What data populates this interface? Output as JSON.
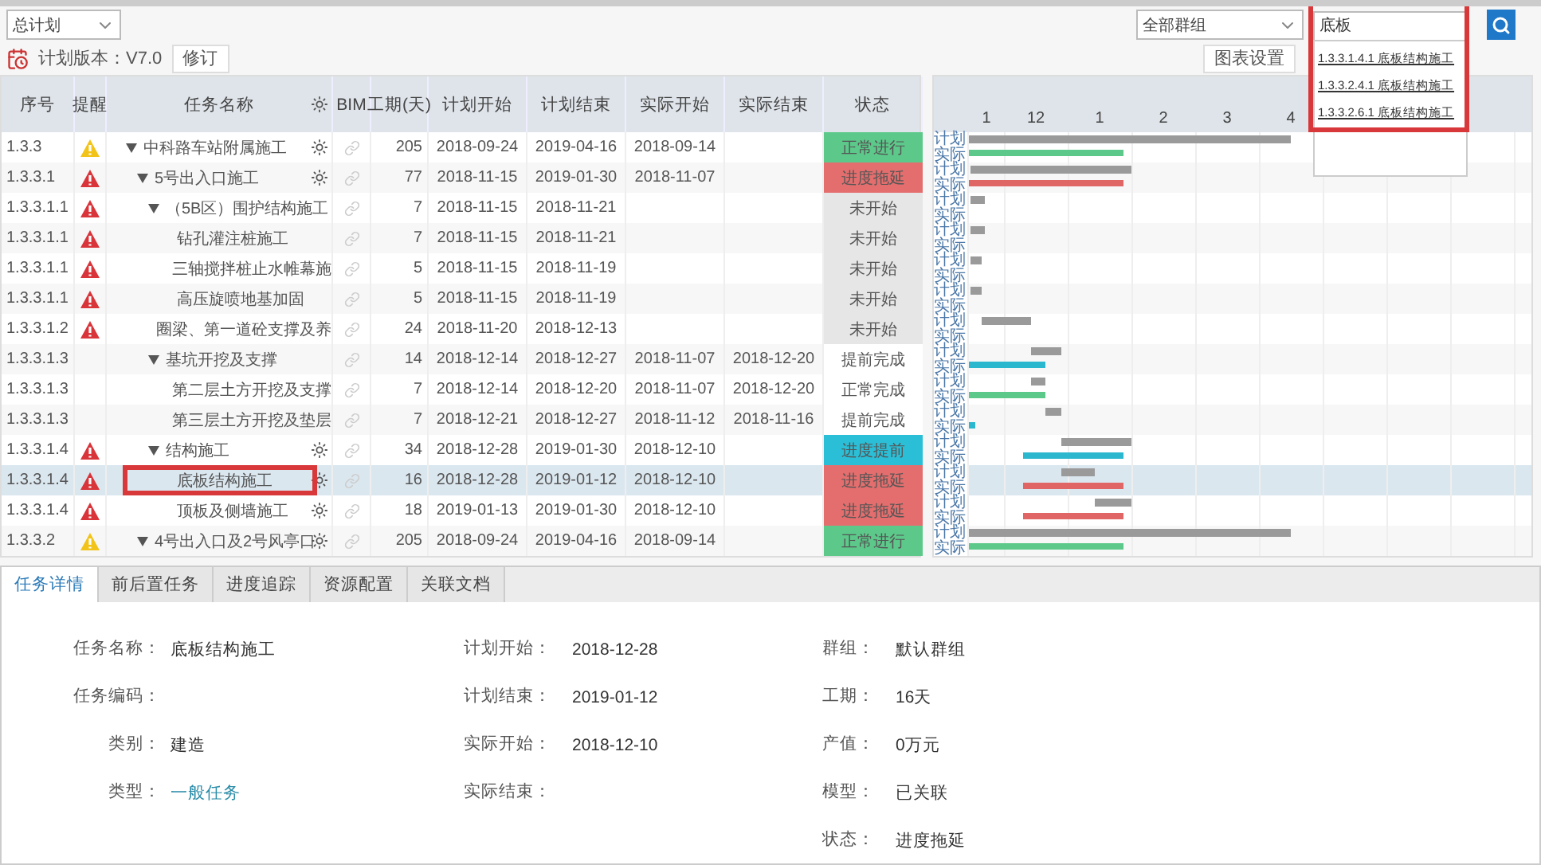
{
  "toolbar": {
    "plan_select": "总计划",
    "version_label": "计划版本：V7.0",
    "revise_button": "修订",
    "group_select": "全部群组",
    "search": {
      "value": "底板",
      "annotated": true,
      "results": [
        {
          "text": "1.3.3.1.4.1 底板结构施工"
        },
        {
          "text": "1.3.3.2.4.1 底板结构施工"
        },
        {
          "text": "1.3.3.2.6.1 底板结构施工"
        }
      ]
    },
    "chart_settings_button": "图表设置"
  },
  "table": {
    "columns": [
      "序号",
      "提醒",
      "任务名称",
      "BIM",
      "工期(天)",
      "计划开始",
      "计划结束",
      "实际开始",
      "实际结束",
      "状态"
    ],
    "rows": [
      {
        "seq": "1.3.3",
        "alert": {
          "color": "#f2c318"
        },
        "name": "中科路车站附属施工",
        "gear": true,
        "duration": "205",
        "plan_start": "2018-09-24",
        "plan_end": "2019-04-16",
        "actual_start": "2018-09-14",
        "status": {
          "text": "正常进行",
          "kind": "normal"
        },
        "expanded": true,
        "selected": false,
        "annotated": false,
        "children": [
          {
            "seq": "1.3.3.1",
            "alert": {
              "color": "#d8343a"
            },
            "name": "5号出入口施工",
            "gear": true,
            "duration": "77",
            "plan_start": "2018-11-15",
            "plan_end": "2019-01-30",
            "actual_start": "2018-11-07",
            "status": {
              "text": "进度拖延",
              "kind": "delayed"
            },
            "expanded": true,
            "selected": false,
            "annotated": false,
            "children": [
              {
                "seq": "1.3.3.1.1",
                "alert": {
                  "color": "#d8343a"
                },
                "name": "（5B区）围护结构施工",
                "gear": false,
                "duration": "7",
                "plan_start": "2018-11-15",
                "plan_end": "2018-11-21",
                "status": {
                  "text": "未开始",
                  "kind": "not_started"
                },
                "expanded": true,
                "selected": false,
                "annotated": false,
                "children": [
                  {
                    "seq": "1.3.3.1.1",
                    "alert": {
                      "color": "#d8343a"
                    },
                    "name": "钻孔灌注桩施工",
                    "gear": false,
                    "duration": "7",
                    "plan_start": "2018-11-15",
                    "plan_end": "2018-11-21",
                    "status": {
                      "text": "未开始",
                      "kind": "not_started"
                    },
                    "selected": false,
                    "annotated": false
                  },
                  {
                    "seq": "1.3.3.1.1",
                    "alert": {
                      "color": "#d8343a"
                    },
                    "name": "三轴搅拌桩止水帷幕施",
                    "gear": false,
                    "duration": "5",
                    "plan_start": "2018-11-15",
                    "plan_end": "2018-11-19",
                    "status": {
                      "text": "未开始",
                      "kind": "not_started"
                    },
                    "selected": false,
                    "annotated": false
                  },
                  {
                    "seq": "1.3.3.1.1",
                    "alert": {
                      "color": "#d8343a"
                    },
                    "name": "高压旋喷地基加固",
                    "gear": false,
                    "duration": "5",
                    "plan_start": "2018-11-15",
                    "plan_end": "2018-11-19",
                    "status": {
                      "text": "未开始",
                      "kind": "not_started"
                    },
                    "selected": false,
                    "annotated": false
                  }
                ]
              },
              {
                "seq": "1.3.3.1.2",
                "alert": {
                  "color": "#d8343a"
                },
                "name": "圈梁、第一道砼支撑及养",
                "gear": false,
                "duration": "24",
                "plan_start": "2018-11-20",
                "plan_end": "2018-12-13",
                "status": {
                  "text": "未开始",
                  "kind": "not_started"
                },
                "selected": false,
                "annotated": false
              },
              {
                "seq": "1.3.3.1.3",
                "name": "基坑开挖及支撑",
                "gear": false,
                "duration": "14",
                "plan_start": "2018-12-14",
                "plan_end": "2018-12-27",
                "actual_start": "2018-11-07",
                "actual_end": "2018-12-20",
                "status": {
                  "text": "提前完成",
                  "kind": "early_done"
                },
                "expanded": true,
                "selected": false,
                "annotated": false,
                "children": [
                  {
                    "seq": "1.3.3.1.3",
                    "name": "第二层土方开挖及支撑",
                    "gear": false,
                    "duration": "7",
                    "plan_start": "2018-12-14",
                    "plan_end": "2018-12-20",
                    "actual_start": "2018-11-07",
                    "actual_end": "2018-12-20",
                    "status": {
                      "text": "正常完成",
                      "kind": "normal_done"
                    },
                    "selected": false,
                    "annotated": false
                  },
                  {
                    "seq": "1.3.3.1.3",
                    "name": "第三层土方开挖及垫层",
                    "gear": false,
                    "duration": "7",
                    "plan_start": "2018-12-21",
                    "plan_end": "2018-12-27",
                    "actual_start": "2018-11-12",
                    "actual_end": "2018-11-16",
                    "status": {
                      "text": "提前完成",
                      "kind": "early_done"
                    },
                    "selected": false,
                    "annotated": false
                  }
                ]
              },
              {
                "seq": "1.3.3.1.4",
                "alert": {
                  "color": "#d8343a"
                },
                "name": "结构施工",
                "gear": true,
                "duration": "34",
                "plan_start": "2018-12-28",
                "plan_end": "2019-01-30",
                "actual_start": "2018-12-10",
                "status": {
                  "text": "进度提前",
                  "kind": "ahead"
                },
                "expanded": true,
                "selected": false,
                "annotated": false,
                "children": [
                  {
                    "seq": "1.3.3.1.4",
                    "alert": {
                      "color": "#d8343a"
                    },
                    "name": "底板结构施工",
                    "gear": true,
                    "duration": "16",
                    "plan_start": "2018-12-28",
                    "plan_end": "2019-01-12",
                    "actual_start": "2018-12-10",
                    "status": {
                      "text": "进度拖延",
                      "kind": "delayed"
                    },
                    "selected": true,
                    "annotated": true
                  },
                  {
                    "seq": "1.3.3.1.4",
                    "alert": {
                      "color": "#d8343a"
                    },
                    "name": "顶板及侧墙施工",
                    "gear": true,
                    "duration": "18",
                    "plan_start": "2019-01-13",
                    "plan_end": "2019-01-30",
                    "actual_start": "2018-12-10",
                    "status": {
                      "text": "进度拖延",
                      "kind": "delayed"
                    },
                    "selected": false,
                    "annotated": false
                  }
                ]
              }
            ]
          },
          {
            "seq": "1.3.3.2",
            "alert": {
              "color": "#f2c318"
            },
            "name": "4号出入口及2号风亭口",
            "gear": true,
            "duration": "205",
            "plan_start": "2018-09-24",
            "plan_end": "2019-04-16",
            "actual_start": "2018-09-14",
            "status": {
              "text": "正常进行",
              "kind": "normal"
            },
            "expanded": true,
            "selected": false,
            "annotated": false
          }
        ]
      }
    ]
  },
  "gantt": {
    "months": [
      "1",
      "12",
      "1",
      "2",
      "3",
      "4"
    ],
    "rows": [
      {
        "plan": "计划",
        "actual": "实际"
      },
      {
        "plan": "计划",
        "actual": "实际"
      },
      {
        "plan": "计划",
        "actual": "实际"
      },
      {
        "plan": "计划",
        "actual": "实际"
      },
      {
        "plan": "计划",
        "actual": "实际"
      },
      {
        "plan": "计划",
        "actual": "实际"
      },
      {
        "plan": "计划",
        "actual": "实际"
      },
      {
        "plan": "计划",
        "actual": "实际"
      },
      {
        "plan": "计划",
        "actual": "实际"
      },
      {
        "plan": "计划",
        "actual": "实际"
      },
      {
        "plan": "计划",
        "actual": "实际"
      },
      {
        "plan": "计划",
        "actual": "实际"
      },
      {
        "plan": "计划",
        "actual": "实际"
      },
      {
        "plan": "计划",
        "actual": "实际"
      }
    ]
  },
  "details": {
    "tabs": [
      {
        "label": "任务详情",
        "selected": true
      },
      {
        "label": "前后置任务",
        "selected": false
      },
      {
        "label": "进度追踪",
        "selected": false
      },
      {
        "label": "资源配置",
        "selected": false
      },
      {
        "label": "关联文档",
        "selected": false
      }
    ],
    "columns": [
      [
        {
          "label": "任务名称：",
          "value": "底板结构施工",
          "kind": "text"
        },
        {
          "label": "任务编码："
        },
        {
          "label": "类别：",
          "value": "建造",
          "kind": "text"
        },
        {
          "label": "类型：",
          "value": "一般任务",
          "kind": "link"
        }
      ],
      [
        {
          "label": "计划开始：",
          "value": "2018-12-28",
          "kind": "text"
        },
        {
          "label": "计划结束：",
          "value": "2019-01-12",
          "kind": "text"
        },
        {
          "label": "实际开始：",
          "value": "2018-12-10",
          "kind": "text"
        },
        {
          "label": "实际结束："
        }
      ],
      [
        {
          "label": "群组：",
          "value": "默认群组",
          "kind": "text"
        },
        {
          "label": "工期：",
          "value": "16天",
          "kind": "text"
        },
        {
          "label": "产值：",
          "value": "0万元",
          "kind": "text"
        },
        {
          "label": "模型：",
          "value": "已关联",
          "kind": "text"
        },
        {
          "label": "状态：",
          "value": "进度拖延",
          "kind": "text"
        }
      ]
    ]
  }
}
